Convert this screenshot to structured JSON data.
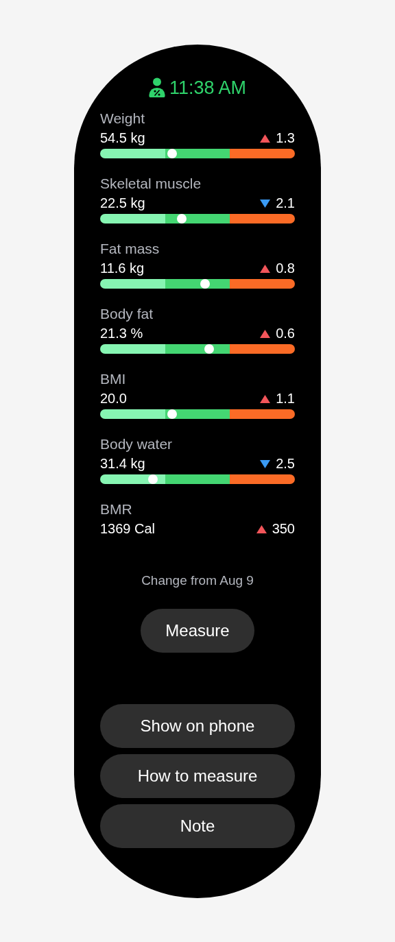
{
  "header": {
    "time": "11:38 AM"
  },
  "metrics": [
    {
      "name": "Weight",
      "value": "54.5 kg",
      "kind": "up",
      "change": "1.3",
      "level": 0.37
    },
    {
      "name": "Skeletal muscle",
      "value": "22.5 kg",
      "kind": "down",
      "change": "2.1",
      "level": 0.42
    },
    {
      "name": "Fat mass",
      "value": "11.6 kg",
      "kind": "up",
      "change": "0.8",
      "level": 0.54
    },
    {
      "name": "Body fat",
      "value": "21.3 %",
      "kind": "up",
      "change": "0.6",
      "level": 0.56
    },
    {
      "name": "BMI",
      "value": "20.0",
      "kind": "up",
      "change": "1.1",
      "level": 0.37
    },
    {
      "name": "Body water",
      "value": "31.4 kg",
      "kind": "down",
      "change": "2.5",
      "level": 0.27
    },
    {
      "name": "BMR",
      "value": "1369 Cal",
      "kind": "up",
      "change": "350"
    }
  ],
  "note": "Change from Aug 9",
  "measure_button": "Measure",
  "buttons": [
    "Show on phone",
    "How to measure",
    "Note"
  ]
}
